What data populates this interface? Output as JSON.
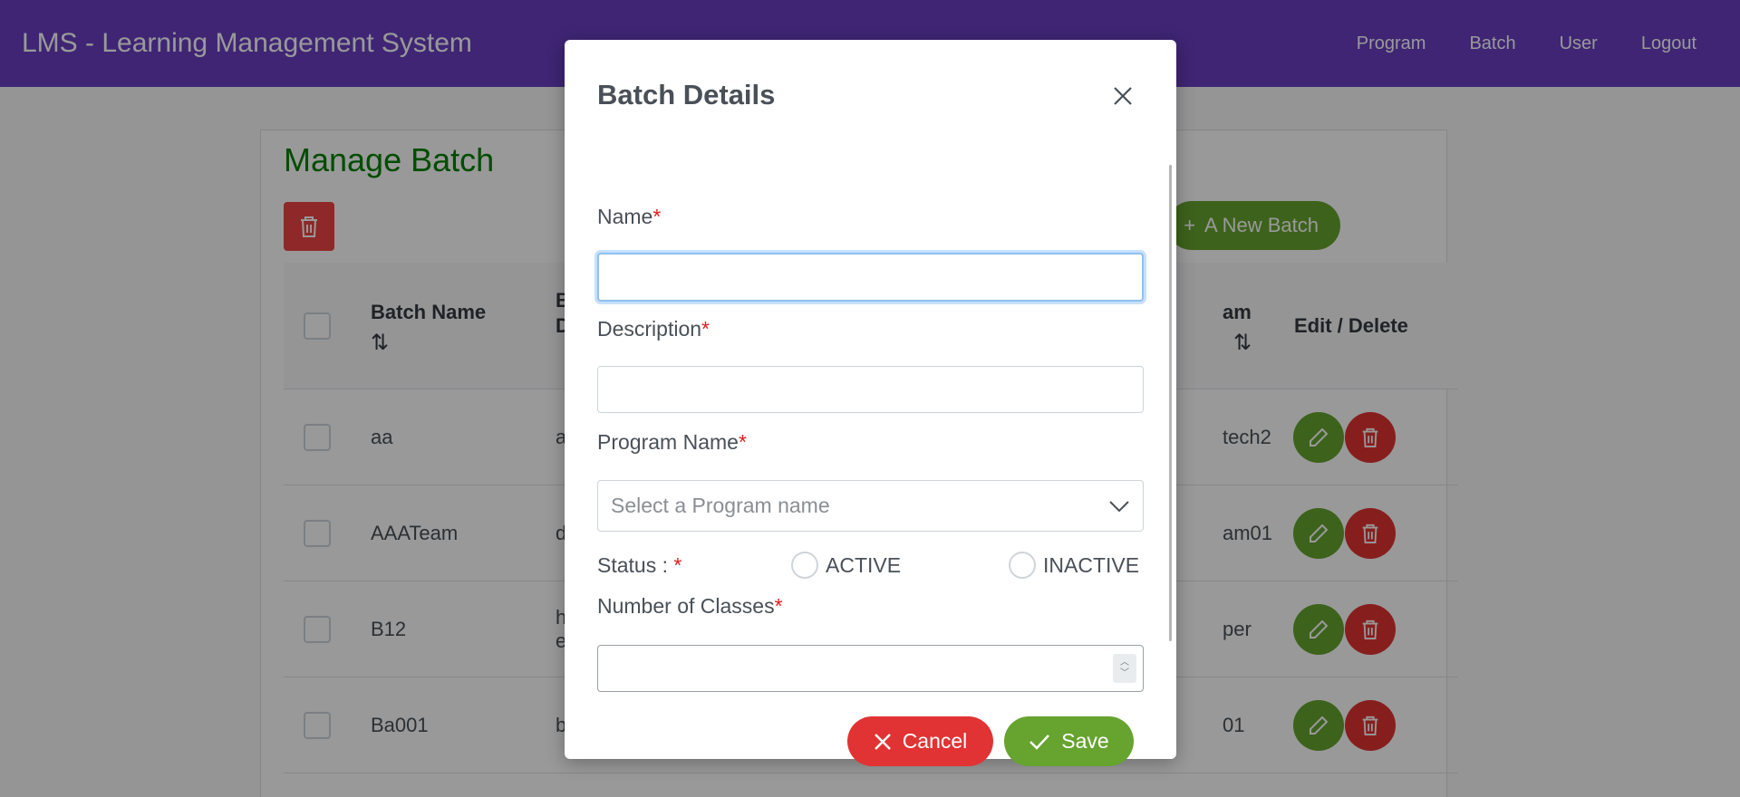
{
  "navbar": {
    "title": "LMS - Learning Management System",
    "links": [
      "Program",
      "Batch",
      "User",
      "Logout"
    ]
  },
  "page": {
    "title": "Manage Batch",
    "new_button": "A New Batch",
    "columns": {
      "batch_name": "Batch Name",
      "batch_desc_partial": "B\nD",
      "program_partial": "am",
      "actions": "Edit / Delete"
    },
    "rows": [
      {
        "name": "aa",
        "desc": "a",
        "program": "tech2"
      },
      {
        "name": "AAATeam",
        "desc": "d",
        "program": "am01"
      },
      {
        "name": "B12",
        "desc": "h\ne",
        "program": "per"
      },
      {
        "name": "Ba001",
        "desc": "b",
        "program": "01"
      }
    ]
  },
  "dialog": {
    "title": "Batch Details",
    "fields": {
      "name_label": "Name",
      "name_value": "",
      "description_label": "Description",
      "description_value": "",
      "program_label": "Program Name",
      "program_placeholder": "Select a Program name",
      "status_label": "Status : ",
      "status_active": "ACTIVE",
      "status_inactive": "INACTIVE",
      "classes_label": "Number of Classes",
      "classes_value": "",
      "required_marker": "*"
    },
    "cancel": "Cancel",
    "save": "Save"
  },
  "colors": {
    "navbar": "#6a3ec2",
    "title_green": "#008000",
    "success": "#66a32f",
    "danger": "#e13333"
  }
}
